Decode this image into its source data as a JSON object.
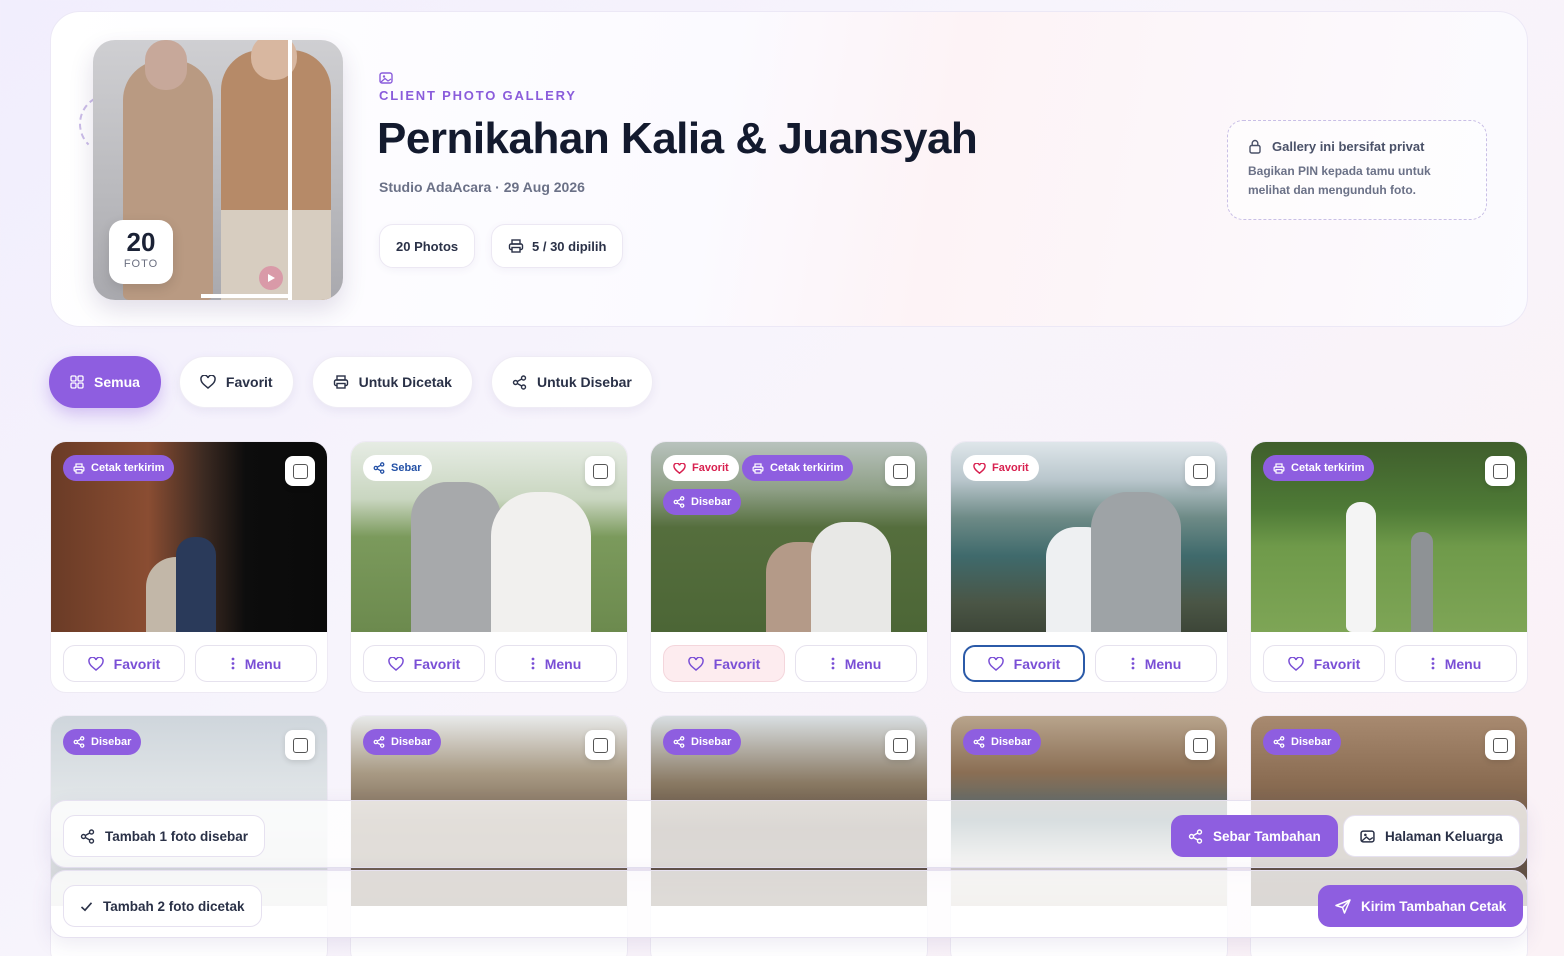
{
  "header": {
    "eyebrow": "CLIENT PHOTO GALLERY",
    "title": "Pernikahan Kalia & Juansyah",
    "subtitle": "Studio AdaAcara · 29 Aug 2026",
    "photo_count": "20",
    "photo_count_label": "FOTO",
    "stat_photos": "20 Photos",
    "stat_print": "5 / 30 dipilih",
    "private_title": "Gallery ini bersifat privat",
    "private_desc": "Bagikan PIN kepada tamu untuk melihat dan mengunduh foto."
  },
  "tabs": [
    {
      "label": "Semua",
      "icon": "grid-icon",
      "active": true
    },
    {
      "label": "Favorit",
      "icon": "heart-icon",
      "active": false
    },
    {
      "label": "Untuk Dicetak",
      "icon": "printer-icon",
      "active": false
    },
    {
      "label": "Untuk Disebar",
      "icon": "share-icon",
      "active": false
    }
  ],
  "tag_labels": {
    "print_sent": "Cetak terkirim",
    "share": "Sebar",
    "shared": "Disebar",
    "favorite": "Favorit"
  },
  "card_buttons": {
    "favorite": "Favorit",
    "menu": "Menu"
  },
  "bottom_bars": {
    "share_info": "Tambah 1 foto disebar",
    "share_action": "Sebar Tambahan",
    "family_page": "Halaman Keluarga",
    "print_info": "Tambah 2 foto dicetak",
    "print_action": "Kirim Tambahan Cetak"
  },
  "colors": {
    "accent": "#8e5ee0",
    "title": "#131a2e",
    "favorite_red": "#d8204f"
  }
}
